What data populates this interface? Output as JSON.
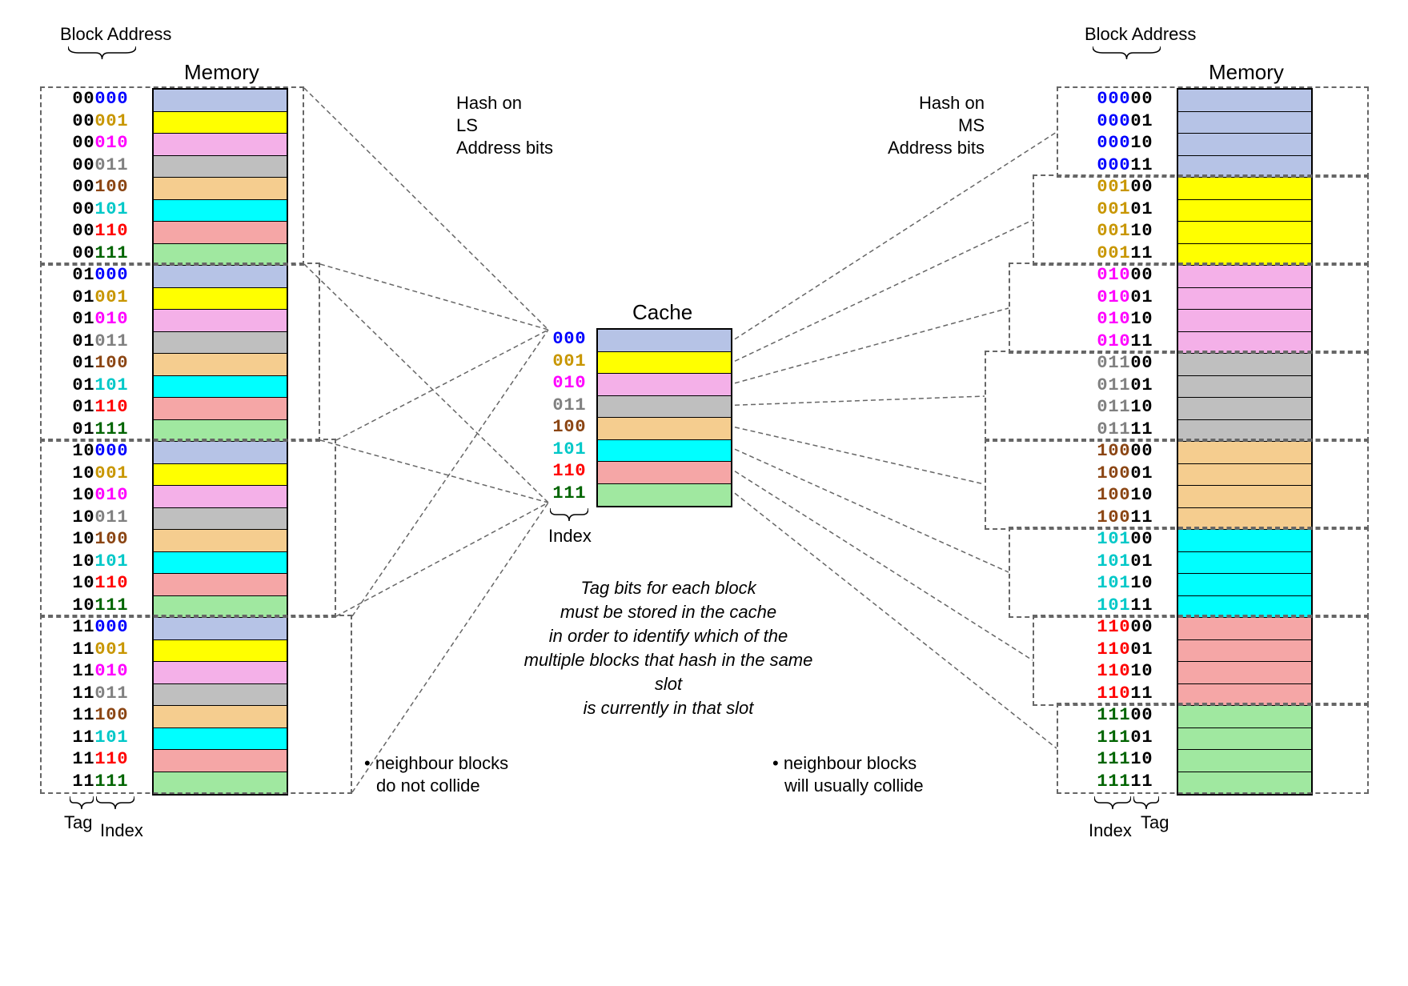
{
  "labels": {
    "block_address": "Block Address",
    "memory": "Memory",
    "cache": "Cache",
    "index": "Index",
    "tag": "Tag",
    "hash_ls_1": "Hash on",
    "hash_ls_2": "LS",
    "hash_ls_3": "Address bits",
    "hash_ms_1": "Hash on",
    "hash_ms_2": "MS",
    "hash_ms_3": "Address bits",
    "neighbour_no_collide_1": "• neighbour blocks",
    "neighbour_no_collide_2": "do not collide",
    "neighbour_collide_1": "• neighbour blocks",
    "neighbour_collide_2": "will usually collide",
    "italic_1": "Tag bits for each block",
    "italic_2": "must be stored in the cache",
    "italic_3": "in order to identify which of the",
    "italic_4": "multiple blocks that hash in the same slot",
    "italic_5": "is currently in that slot"
  },
  "colors": {
    "c000": "#b6c3e6",
    "c001": "#ffff00",
    "c010": "#f4b0e8",
    "c011": "#bfbfbf",
    "c100": "#f5cd8f",
    "c101": "#00ffff",
    "c110": "#f5a6a6",
    "c111": "#a0e8a0"
  },
  "bit_colors": {
    "000": "#0000ff",
    "001": "#c89600",
    "010": "#ff00ff",
    "011": "#808080",
    "100": "#8b4513",
    "101": "#00c8c8",
    "110": "#ff0000",
    "111": "#006400"
  },
  "left_mem": {
    "tag_bits": 2,
    "index_bits": 3,
    "addresses": [
      {
        "tag": "00",
        "idx": "000"
      },
      {
        "tag": "00",
        "idx": "001"
      },
      {
        "tag": "00",
        "idx": "010"
      },
      {
        "tag": "00",
        "idx": "011"
      },
      {
        "tag": "00",
        "idx": "100"
      },
      {
        "tag": "00",
        "idx": "101"
      },
      {
        "tag": "00",
        "idx": "110"
      },
      {
        "tag": "00",
        "idx": "111"
      },
      {
        "tag": "01",
        "idx": "000"
      },
      {
        "tag": "01",
        "idx": "001"
      },
      {
        "tag": "01",
        "idx": "010"
      },
      {
        "tag": "01",
        "idx": "011"
      },
      {
        "tag": "01",
        "idx": "100"
      },
      {
        "tag": "01",
        "idx": "101"
      },
      {
        "tag": "01",
        "idx": "110"
      },
      {
        "tag": "01",
        "idx": "111"
      },
      {
        "tag": "10",
        "idx": "000"
      },
      {
        "tag": "10",
        "idx": "001"
      },
      {
        "tag": "10",
        "idx": "010"
      },
      {
        "tag": "10",
        "idx": "011"
      },
      {
        "tag": "10",
        "idx": "100"
      },
      {
        "tag": "10",
        "idx": "101"
      },
      {
        "tag": "10",
        "idx": "110"
      },
      {
        "tag": "10",
        "idx": "111"
      },
      {
        "tag": "11",
        "idx": "000"
      },
      {
        "tag": "11",
        "idx": "001"
      },
      {
        "tag": "11",
        "idx": "010"
      },
      {
        "tag": "11",
        "idx": "011"
      },
      {
        "tag": "11",
        "idx": "100"
      },
      {
        "tag": "11",
        "idx": "101"
      },
      {
        "tag": "11",
        "idx": "110"
      },
      {
        "tag": "11",
        "idx": "111"
      }
    ]
  },
  "right_mem": {
    "index_bits": 3,
    "tag_bits": 2,
    "addresses": [
      {
        "idx": "000",
        "tag": "00"
      },
      {
        "idx": "000",
        "tag": "01"
      },
      {
        "idx": "000",
        "tag": "10"
      },
      {
        "idx": "000",
        "tag": "11"
      },
      {
        "idx": "001",
        "tag": "00"
      },
      {
        "idx": "001",
        "tag": "01"
      },
      {
        "idx": "001",
        "tag": "10"
      },
      {
        "idx": "001",
        "tag": "11"
      },
      {
        "idx": "010",
        "tag": "00"
      },
      {
        "idx": "010",
        "tag": "01"
      },
      {
        "idx": "010",
        "tag": "10"
      },
      {
        "idx": "010",
        "tag": "11"
      },
      {
        "idx": "011",
        "tag": "00"
      },
      {
        "idx": "011",
        "tag": "01"
      },
      {
        "idx": "011",
        "tag": "10"
      },
      {
        "idx": "011",
        "tag": "11"
      },
      {
        "idx": "100",
        "tag": "00"
      },
      {
        "idx": "100",
        "tag": "01"
      },
      {
        "idx": "100",
        "tag": "10"
      },
      {
        "idx": "100",
        "tag": "11"
      },
      {
        "idx": "101",
        "tag": "00"
      },
      {
        "idx": "101",
        "tag": "01"
      },
      {
        "idx": "101",
        "tag": "10"
      },
      {
        "idx": "101",
        "tag": "11"
      },
      {
        "idx": "110",
        "tag": "00"
      },
      {
        "idx": "110",
        "tag": "01"
      },
      {
        "idx": "110",
        "tag": "10"
      },
      {
        "idx": "110",
        "tag": "11"
      },
      {
        "idx": "111",
        "tag": "00"
      },
      {
        "idx": "111",
        "tag": "01"
      },
      {
        "idx": "111",
        "tag": "10"
      },
      {
        "idx": "111",
        "tag": "11"
      }
    ]
  },
  "cache": {
    "slots": [
      "000",
      "001",
      "010",
      "011",
      "100",
      "101",
      "110",
      "111"
    ]
  }
}
